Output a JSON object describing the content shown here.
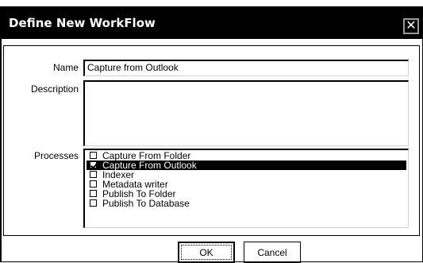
{
  "dialog": {
    "title": "Define New WorkFlow",
    "close_icon": "close-icon"
  },
  "form": {
    "name_label": "Name",
    "name_value": "Capture from Outlook",
    "description_label": "Description",
    "description_value": "",
    "processes_label": "Processes",
    "processes": [
      {
        "label": "Capture From Folder",
        "checked": false,
        "selected": false
      },
      {
        "label": "Capture From Outlook",
        "checked": true,
        "selected": true
      },
      {
        "label": "Indexer",
        "checked": false,
        "selected": false
      },
      {
        "label": "Metadata writer",
        "checked": false,
        "selected": false
      },
      {
        "label": "Publish To Folder",
        "checked": false,
        "selected": false
      },
      {
        "label": "Publish To Database",
        "checked": false,
        "selected": false
      }
    ]
  },
  "buttons": {
    "ok_label": "OK",
    "cancel_label": "Cancel"
  }
}
